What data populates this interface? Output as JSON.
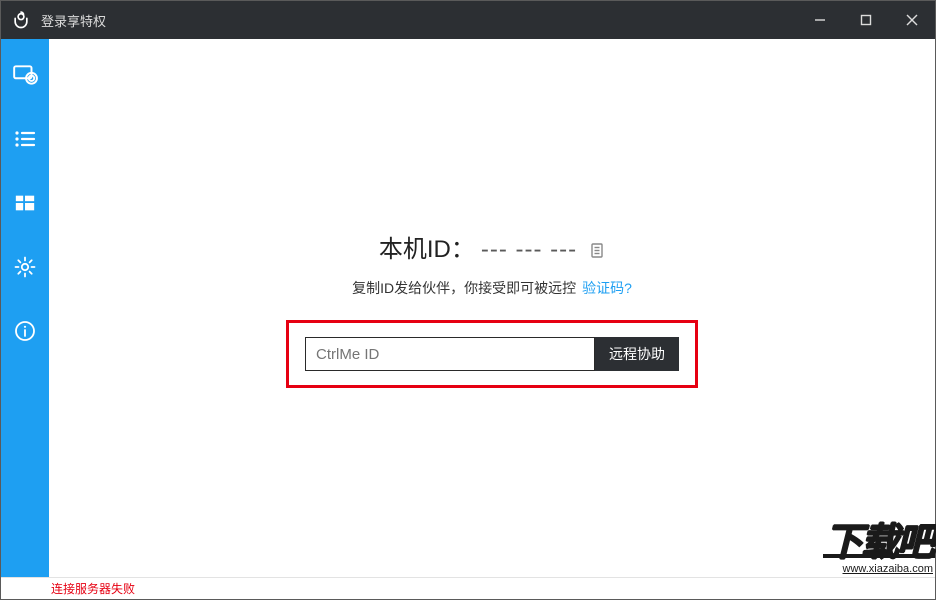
{
  "titlebar": {
    "title": "登录享特权"
  },
  "main": {
    "local_id_label": "本机ID：",
    "local_id_value": "--- --- ---",
    "hint": "复制ID发给伙伴，你接受即可被远控",
    "verify_link": "验证码?",
    "input_placeholder": "CtrlMe ID",
    "remote_button": "远程协助"
  },
  "status": {
    "text": "连接服务器失败"
  },
  "watermark": {
    "main": "下载吧",
    "sub": "www.xiazaiba.com"
  }
}
